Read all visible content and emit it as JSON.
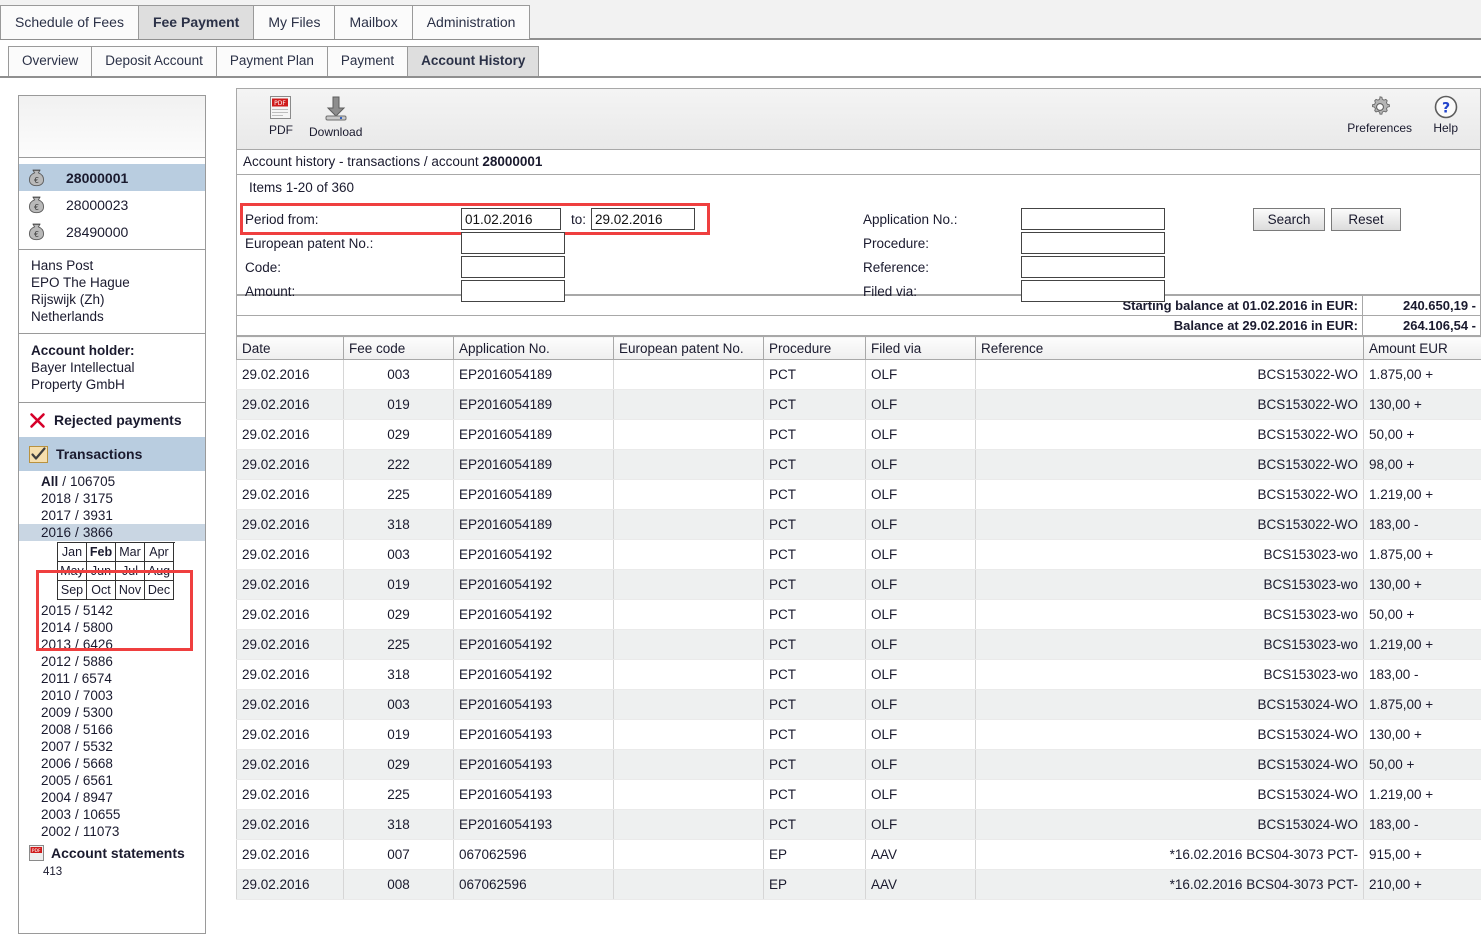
{
  "main_tabs": [
    {
      "label": "Schedule of Fees",
      "active": false
    },
    {
      "label": "Fee Payment",
      "active": true
    },
    {
      "label": "My Files",
      "active": false
    },
    {
      "label": "Mailbox",
      "active": false
    },
    {
      "label": "Administration",
      "active": false
    }
  ],
  "sub_tabs": [
    {
      "label": "Overview",
      "active": false
    },
    {
      "label": "Deposit Account",
      "active": false
    },
    {
      "label": "Payment Plan",
      "active": false
    },
    {
      "label": "Payment",
      "active": false
    },
    {
      "label": "Account History",
      "active": true
    }
  ],
  "toolbar": {
    "pdf_label": "PDF",
    "download_label": "Download",
    "preferences_label": "Preferences",
    "help_label": "Help"
  },
  "breadcrumb": {
    "text": "Account history - transactions / account ",
    "account": "28000001"
  },
  "items_line": "Items 1-20 of 360",
  "search_form": {
    "period_from_label": "Period from:",
    "period_from_value": "01.02.2016",
    "to_label": "to:",
    "period_to_value": "29.02.2016",
    "european_patent_label": "European patent No.:",
    "european_patent_value": "",
    "code_label": "Code:",
    "code_value": "",
    "amount_label": "Amount:",
    "amount_value": "",
    "application_label": "Application No.:",
    "application_value": "",
    "procedure_label": "Procedure:",
    "procedure_value": "",
    "reference_label": "Reference:",
    "reference_value": "",
    "filed_via_label": "Filed via:",
    "filed_via_value": "",
    "search_label": "Search",
    "reset_label": "Reset",
    "highlight_color": "#ef3f3f"
  },
  "balances": [
    {
      "label": "Starting balance at 01.02.2016 in EUR:",
      "value": "240.650,19 -"
    },
    {
      "label": "Balance at 29.02.2016 in EUR:",
      "value": "264.106,54 -"
    }
  ],
  "table": {
    "columns": [
      "Date",
      "Fee code",
      "Application No.",
      "European patent No.",
      "Procedure",
      "Filed via",
      "Reference",
      "Amount  EUR"
    ],
    "rows": [
      {
        "date": "29.02.2016",
        "fee": "003",
        "app": "EP2016054189",
        "epno": "",
        "proc": "PCT",
        "filed": "OLF",
        "ref": "BCS153022-WO",
        "amount": "1.875,00 +"
      },
      {
        "date": "29.02.2016",
        "fee": "019",
        "app": "EP2016054189",
        "epno": "",
        "proc": "PCT",
        "filed": "OLF",
        "ref": "BCS153022-WO",
        "amount": "130,00 +"
      },
      {
        "date": "29.02.2016",
        "fee": "029",
        "app": "EP2016054189",
        "epno": "",
        "proc": "PCT",
        "filed": "OLF",
        "ref": "BCS153022-WO",
        "amount": "50,00 +"
      },
      {
        "date": "29.02.2016",
        "fee": "222",
        "app": "EP2016054189",
        "epno": "",
        "proc": "PCT",
        "filed": "OLF",
        "ref": "BCS153022-WO",
        "amount": "98,00 +"
      },
      {
        "date": "29.02.2016",
        "fee": "225",
        "app": "EP2016054189",
        "epno": "",
        "proc": "PCT",
        "filed": "OLF",
        "ref": "BCS153022-WO",
        "amount": "1.219,00 +"
      },
      {
        "date": "29.02.2016",
        "fee": "318",
        "app": "EP2016054189",
        "epno": "",
        "proc": "PCT",
        "filed": "OLF",
        "ref": "BCS153022-WO",
        "amount": "183,00 -"
      },
      {
        "date": "29.02.2016",
        "fee": "003",
        "app": "EP2016054192",
        "epno": "",
        "proc": "PCT",
        "filed": "OLF",
        "ref": "BCS153023-wo",
        "amount": "1.875,00 +"
      },
      {
        "date": "29.02.2016",
        "fee": "019",
        "app": "EP2016054192",
        "epno": "",
        "proc": "PCT",
        "filed": "OLF",
        "ref": "BCS153023-wo",
        "amount": "130,00 +"
      },
      {
        "date": "29.02.2016",
        "fee": "029",
        "app": "EP2016054192",
        "epno": "",
        "proc": "PCT",
        "filed": "OLF",
        "ref": "BCS153023-wo",
        "amount": "50,00 +"
      },
      {
        "date": "29.02.2016",
        "fee": "225",
        "app": "EP2016054192",
        "epno": "",
        "proc": "PCT",
        "filed": "OLF",
        "ref": "BCS153023-wo",
        "amount": "1.219,00 +"
      },
      {
        "date": "29.02.2016",
        "fee": "318",
        "app": "EP2016054192",
        "epno": "",
        "proc": "PCT",
        "filed": "OLF",
        "ref": "BCS153023-wo",
        "amount": "183,00 -"
      },
      {
        "date": "29.02.2016",
        "fee": "003",
        "app": "EP2016054193",
        "epno": "",
        "proc": "PCT",
        "filed": "OLF",
        "ref": "BCS153024-WO",
        "amount": "1.875,00 +"
      },
      {
        "date": "29.02.2016",
        "fee": "019",
        "app": "EP2016054193",
        "epno": "",
        "proc": "PCT",
        "filed": "OLF",
        "ref": "BCS153024-WO",
        "amount": "130,00 +"
      },
      {
        "date": "29.02.2016",
        "fee": "029",
        "app": "EP2016054193",
        "epno": "",
        "proc": "PCT",
        "filed": "OLF",
        "ref": "BCS153024-WO",
        "amount": "50,00 +"
      },
      {
        "date": "29.02.2016",
        "fee": "225",
        "app": "EP2016054193",
        "epno": "",
        "proc": "PCT",
        "filed": "OLF",
        "ref": "BCS153024-WO",
        "amount": "1.219,00 +"
      },
      {
        "date": "29.02.2016",
        "fee": "318",
        "app": "EP2016054193",
        "epno": "",
        "proc": "PCT",
        "filed": "OLF",
        "ref": "BCS153024-WO",
        "amount": "183,00 -"
      },
      {
        "date": "29.02.2016",
        "fee": "007",
        "app": "067062596",
        "epno": "",
        "proc": "EP",
        "filed": "AAV",
        "ref": "*16.02.2016 BCS04-3073 PCT-",
        "amount": "915,00 +"
      },
      {
        "date": "29.02.2016",
        "fee": "008",
        "app": "067062596",
        "epno": "",
        "proc": "EP",
        "filed": "AAV",
        "ref": "*16.02.2016 BCS04-3073 PCT-",
        "amount": "210,00 +"
      }
    ]
  },
  "sidebar": {
    "accounts": [
      {
        "number": "28000001",
        "selected": true
      },
      {
        "number": "28000023",
        "selected": false
      },
      {
        "number": "28490000",
        "selected": false
      }
    ],
    "address": [
      "Hans Post",
      "EPO The Hague",
      "Rijswijk (Zh)",
      "Netherlands"
    ],
    "holder_label": "Account holder:",
    "holder_lines": [
      "Bayer Intellectual",
      "Property GmbH"
    ],
    "rejected_label": "Rejected payments",
    "transactions_label": "Transactions",
    "years": [
      {
        "year": "All",
        "sep": "/",
        "count": "106705",
        "bold": true,
        "selected": false
      },
      {
        "year": "2018",
        "sep": "/",
        "count": "3175",
        "bold": false,
        "selected": false
      },
      {
        "year": "2017",
        "sep": "/",
        "count": "3931",
        "bold": false,
        "selected": false
      },
      {
        "year": "2016",
        "sep": "/",
        "count": "3866",
        "bold": false,
        "selected": true
      },
      {
        "year": "2015",
        "sep": "/",
        "count": "5142",
        "bold": false,
        "selected": false
      },
      {
        "year": "2014",
        "sep": "/",
        "count": "5800",
        "bold": false,
        "selected": false
      },
      {
        "year": "2013",
        "sep": "/",
        "count": "6426",
        "bold": false,
        "selected": false
      },
      {
        "year": "2012",
        "sep": "/",
        "count": "5886",
        "bold": false,
        "selected": false
      },
      {
        "year": "2011",
        "sep": "/",
        "count": "6574",
        "bold": false,
        "selected": false
      },
      {
        "year": "2010",
        "sep": "/",
        "count": "7003",
        "bold": false,
        "selected": false
      },
      {
        "year": "2009",
        "sep": "/",
        "count": "5300",
        "bold": false,
        "selected": false
      },
      {
        "year": "2008",
        "sep": "/",
        "count": "5166",
        "bold": false,
        "selected": false
      },
      {
        "year": "2007",
        "sep": "/",
        "count": "5532",
        "bold": false,
        "selected": false
      },
      {
        "year": "2006",
        "sep": "/",
        "count": "5668",
        "bold": false,
        "selected": false
      },
      {
        "year": "2005",
        "sep": "/",
        "count": "6561",
        "bold": false,
        "selected": false
      },
      {
        "year": "2004",
        "sep": "/",
        "count": "8947",
        "bold": false,
        "selected": false
      },
      {
        "year": "2003",
        "sep": "/",
        "count": "10655",
        "bold": false,
        "selected": false
      },
      {
        "year": "2002",
        "sep": "/",
        "count": "11073",
        "bold": false,
        "selected": false
      }
    ],
    "months": [
      {
        "label": "Jan",
        "selected": false
      },
      {
        "label": "Feb",
        "selected": true
      },
      {
        "label": "Mar",
        "selected": false
      },
      {
        "label": "Apr",
        "selected": false
      },
      {
        "label": "May",
        "selected": false
      },
      {
        "label": "Jun",
        "selected": false
      },
      {
        "label": "Jul",
        "selected": false
      },
      {
        "label": "Aug",
        "selected": false
      },
      {
        "label": "Sep",
        "selected": false
      },
      {
        "label": "Oct",
        "selected": false
      },
      {
        "label": "Nov",
        "selected": false
      },
      {
        "label": "Dec",
        "selected": false
      }
    ],
    "statements_label": "Account statements",
    "statements_count": "413"
  }
}
